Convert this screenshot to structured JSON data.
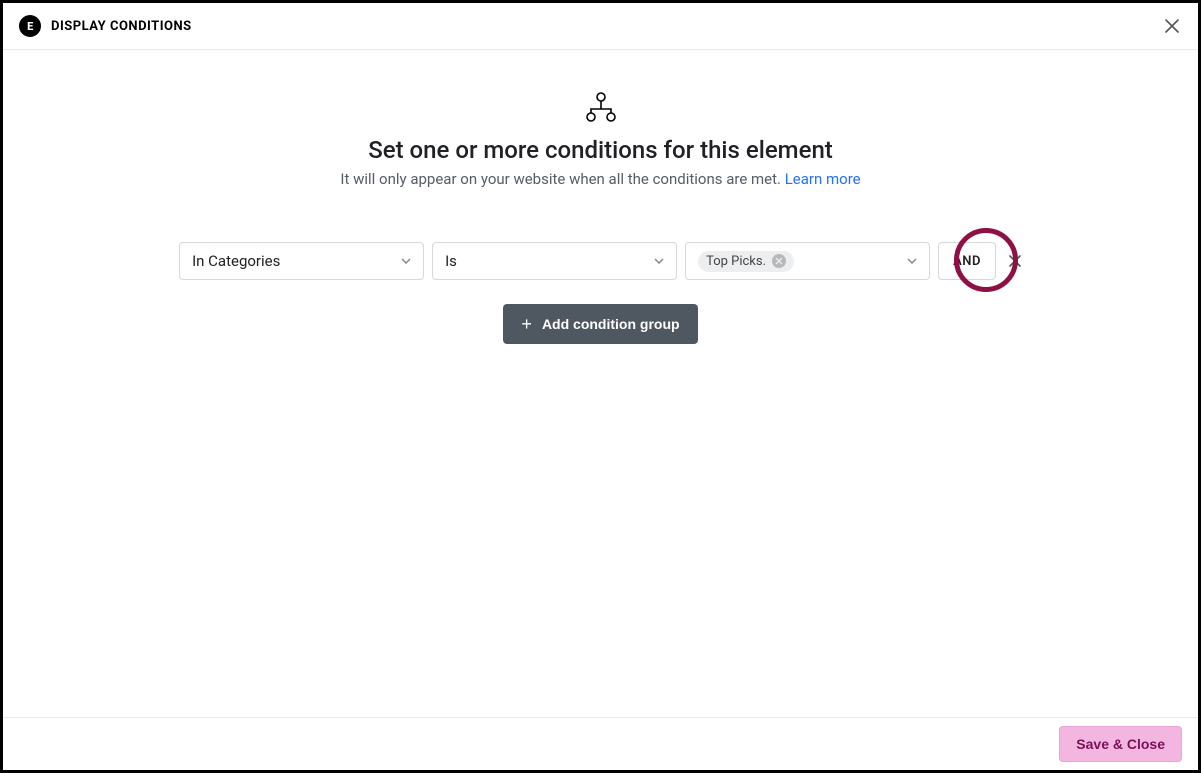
{
  "header": {
    "title": "DISPLAY CONDITIONS"
  },
  "hero": {
    "heading": "Set one or more conditions for this element",
    "sub": "It will only appear on your website when all the conditions are met. ",
    "learn": "Learn more"
  },
  "condition": {
    "type": "In Categories",
    "operator": "Is",
    "value_chip": "Top Picks.",
    "logic": "AND"
  },
  "actions": {
    "add_group": "Add condition group",
    "save": "Save & Close"
  }
}
